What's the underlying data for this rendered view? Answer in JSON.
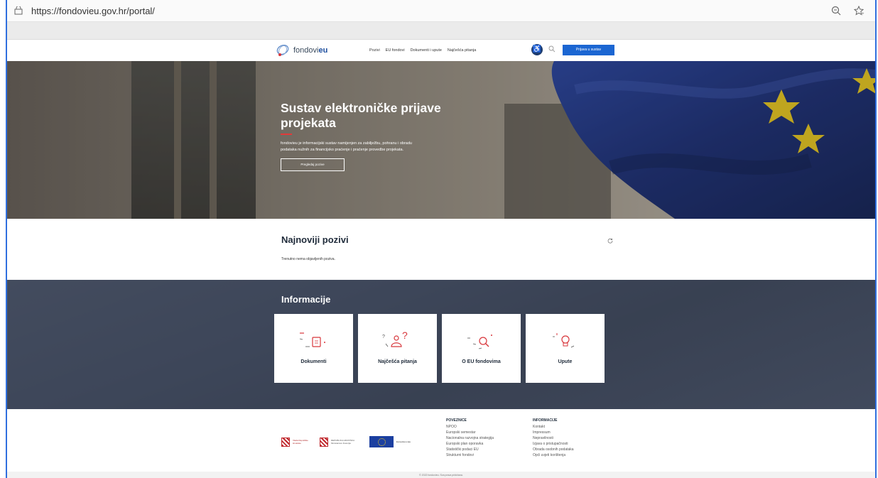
{
  "browser": {
    "url": "https://fondovieu.gov.hr/portal/"
  },
  "nav": {
    "logo_prefix": "fondovi",
    "logo_suffix": "eu",
    "links": [
      "Pozivi",
      "EU fondovi",
      "Dokumenti i upute",
      "Najčešća pitanja"
    ],
    "login_label": "Prijava u sustav"
  },
  "hero": {
    "title": "Sustav elektroničke prijave projekata",
    "description": "fondovieu je informacijski sustav namijenjen za zabilježbu, pohranu i obradu podataka nužnih za financijsko praćenje i praćenje provedbe projekata.",
    "button_label": "Pregledaj pozive"
  },
  "pozivi": {
    "title": "Najnoviji pozivi",
    "empty_text": "Trenutno nema objavljenih poziva."
  },
  "informacije": {
    "title": "Informacije",
    "cards": [
      "Dokumenti",
      "Najčešća pitanja",
      "O EU fondovima",
      "Upute"
    ]
  },
  "footer": {
    "logos": [
      {
        "name": "vlada",
        "text": "Vlada Republike Hrvatske"
      },
      {
        "name": "ministarstvo",
        "text": "REPUBLIKA HRVATSKA Ministarstvo financija"
      },
      {
        "name": "eu",
        "text": "Europska unija"
      }
    ],
    "poveznice": {
      "heading": "POVEZNICE",
      "items": [
        "NPOO",
        "Europski semestar",
        "Nacionalna razvojna strategija",
        "Europski plan oporavka",
        "Statistički podaci EU",
        "Strukturni fondovi"
      ]
    },
    "informacije": {
      "heading": "INFORMACIJE",
      "items": [
        "Kontakt",
        "Impressum",
        "Nepravilnosti",
        "Izjava o pristupačnosti",
        "Obrada osobnih podataka",
        "Opći uvjeti korištenja"
      ]
    },
    "copyright": "© 2022 fondovieu. Sva prava pridržana."
  }
}
